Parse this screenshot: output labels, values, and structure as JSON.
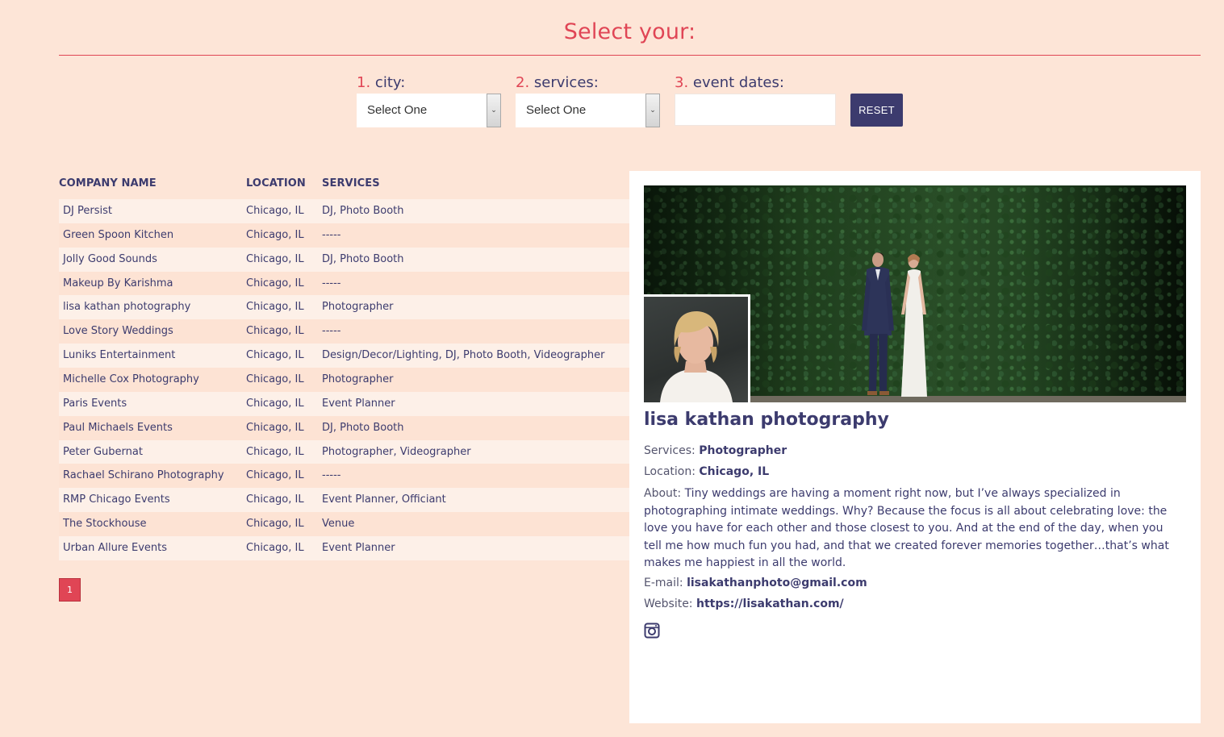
{
  "header": {
    "title": "Select your:"
  },
  "filters": {
    "city": {
      "num": "1.",
      "label": "city:",
      "value": "Select One"
    },
    "services": {
      "num": "2.",
      "label": "services:",
      "value": "Select One"
    },
    "dates": {
      "num": "3.",
      "label": "event dates:",
      "value": ""
    },
    "reset_label": "RESET"
  },
  "table": {
    "columns": [
      "COMPANY NAME",
      "LOCATION",
      "SERVICES"
    ],
    "rows": [
      {
        "company": "DJ Persist",
        "location": "Chicago, IL",
        "services": "DJ, Photo Booth"
      },
      {
        "company": "Green Spoon Kitchen",
        "location": "Chicago, IL",
        "services": "-----"
      },
      {
        "company": "Jolly Good Sounds",
        "location": "Chicago, IL",
        "services": "DJ, Photo Booth"
      },
      {
        "company": "Makeup By Karishma",
        "location": "Chicago, IL",
        "services": "-----"
      },
      {
        "company": "lisa kathan photography",
        "location": "Chicago, IL",
        "services": "Photographer"
      },
      {
        "company": "Love Story Weddings",
        "location": "Chicago, IL",
        "services": "-----"
      },
      {
        "company": "Luniks Entertainment",
        "location": "Chicago, IL",
        "services": "Design/Decor/Lighting, DJ, Photo Booth, Videographer"
      },
      {
        "company": "Michelle Cox Photography",
        "location": "Chicago, IL",
        "services": "Photographer"
      },
      {
        "company": "Paris Events",
        "location": "Chicago, IL",
        "services": "Event Planner"
      },
      {
        "company": "Paul Michaels Events",
        "location": "Chicago, IL",
        "services": "DJ, Photo Booth"
      },
      {
        "company": "Peter Gubernat",
        "location": "Chicago, IL",
        "services": "Photographer, Videographer"
      },
      {
        "company": "Rachael Schirano Photography",
        "location": "Chicago, IL",
        "services": "-----"
      },
      {
        "company": "RMP Chicago Events",
        "location": "Chicago, IL",
        "services": "Event Planner, Officiant"
      },
      {
        "company": "The Stockhouse",
        "location": "Chicago, IL",
        "services": "Venue"
      },
      {
        "company": "Urban Allure Events",
        "location": "Chicago, IL",
        "services": "Event Planner"
      }
    ]
  },
  "pagination": {
    "current_page": "1"
  },
  "detail": {
    "name": "lisa kathan photography",
    "services_label": "Services:",
    "services": "Photographer",
    "location_label": "Location:",
    "location": "Chicago, IL",
    "about_label": "About:",
    "about_lines": [
      "Tiny weddings are having a moment right now, but I’ve always specialized in",
      "photographing intimate weddings. Why? Because the focus is all about celebrating love: the",
      "love you have for each other and those closest to you. And at the end of the day, when you",
      "tell me how much fun you had, and that we created forever memories together…that’s what",
      "makes me happiest in all the world."
    ],
    "email_label": "E-mail:",
    "email": "lisakathanphoto@gmail.com",
    "website_label": "Website:",
    "website": "https://lisakathan.com/",
    "social_icon": "instagram-icon"
  },
  "colors": {
    "background": "#fde5d7",
    "accent": "#e04555",
    "navy": "#3c3b6e"
  }
}
